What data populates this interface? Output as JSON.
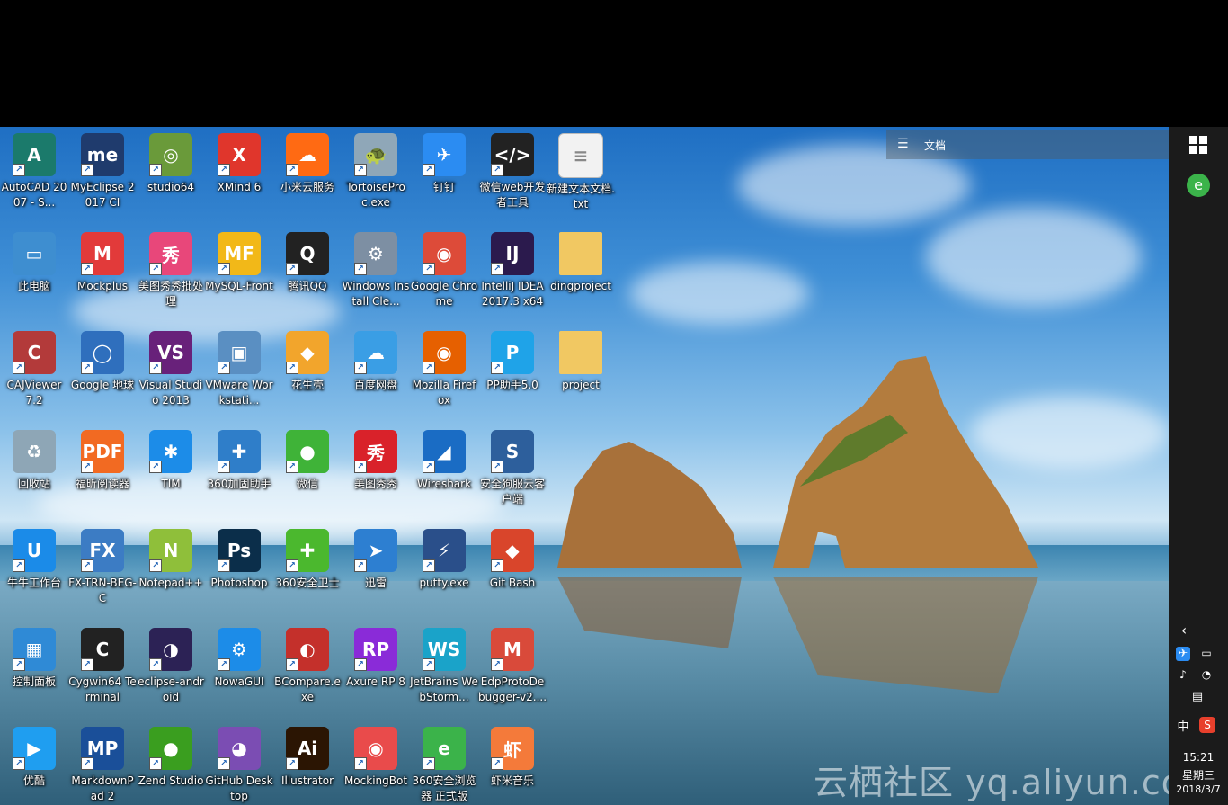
{
  "notebar": {
    "label": "文档"
  },
  "watermark": "云栖社区 yq.aliyun.com",
  "icons": [
    {
      "label": "AutoCAD 2007 - S...",
      "icon": "autocad-icon",
      "bg": "#1b7a6b",
      "glyph": "A"
    },
    {
      "label": "MyEclipse 2017 CI",
      "icon": "myeclipse-icon",
      "bg": "#1f3b6d",
      "glyph": "me"
    },
    {
      "label": "studio64",
      "icon": "android-studio-icon",
      "bg": "#6a9a3a",
      "glyph": "◎"
    },
    {
      "label": "XMind 6",
      "icon": "xmind-icon",
      "bg": "#e0362c",
      "glyph": "X"
    },
    {
      "label": "小米云服务",
      "icon": "mi-cloud-icon",
      "bg": "#ff6a13",
      "glyph": "☁"
    },
    {
      "label": "TortoiseProc.exe",
      "icon": "tortoise-icon",
      "bg": "#8fa7b8",
      "glyph": "🐢"
    },
    {
      "label": "钉钉",
      "icon": "dingtalk-icon",
      "bg": "#2b8cf2",
      "glyph": "✈"
    },
    {
      "label": "微信web开发者工具",
      "icon": "wechat-devtools-icon",
      "bg": "#222",
      "glyph": "</>"
    },
    {
      "label": "新建文本文档.txt",
      "icon": "text-file-icon",
      "bg": "#f2f2f2",
      "glyph": "≡"
    },
    {
      "label": "此电脑",
      "icon": "computer-icon",
      "bg": "#3e8ed0",
      "glyph": "▭"
    },
    {
      "label": "Mockplus",
      "icon": "mockplus-icon",
      "bg": "#e23a3a",
      "glyph": "M"
    },
    {
      "label": "美图秀秀批处理",
      "icon": "meitu-batch-icon",
      "bg": "#e8477a",
      "glyph": "秀"
    },
    {
      "label": "MySQL-Front",
      "icon": "mysql-front-icon",
      "bg": "#f2b818",
      "glyph": "MF"
    },
    {
      "label": "腾讯QQ",
      "icon": "qq-icon",
      "bg": "#222",
      "glyph": "Q"
    },
    {
      "label": "Windows Install Cle...",
      "icon": "windows-installer-icon",
      "bg": "#7d8fa3",
      "glyph": "⚙"
    },
    {
      "label": "Google Chrome",
      "icon": "chrome-icon",
      "bg": "#dd4b39",
      "glyph": "◉"
    },
    {
      "label": "IntelliJ IDEA 2017.3 x64",
      "icon": "intellij-icon",
      "bg": "#2b1a4d",
      "glyph": "IJ"
    },
    {
      "label": "dingproject",
      "icon": "folder-icon",
      "bg": "#f1c862",
      "glyph": ""
    },
    {
      "label": "CAJViewer 7.2",
      "icon": "cajviewer-icon",
      "bg": "#b33a3a",
      "glyph": "C"
    },
    {
      "label": "Google 地球",
      "icon": "google-earth-icon",
      "bg": "#2f6fbd",
      "glyph": "◯"
    },
    {
      "label": "Visual Studio 2013",
      "icon": "visual-studio-icon",
      "bg": "#68217a",
      "glyph": "VS"
    },
    {
      "label": "VMware Workstati...",
      "icon": "vmware-icon",
      "bg": "#5a8fc2",
      "glyph": "▣"
    },
    {
      "label": "花生壳",
      "icon": "peanut-shell-icon",
      "bg": "#f2a52c",
      "glyph": "◆"
    },
    {
      "label": "百度网盘",
      "icon": "baidu-netdisk-icon",
      "bg": "#3a9ee5",
      "glyph": "☁"
    },
    {
      "label": "Mozilla Firefox",
      "icon": "firefox-icon",
      "bg": "#e66000",
      "glyph": "◉"
    },
    {
      "label": "PP助手5.0",
      "icon": "pp-assistant-icon",
      "bg": "#1fa3e8",
      "glyph": "P"
    },
    {
      "label": "project",
      "icon": "folder-icon",
      "bg": "#f1c862",
      "glyph": ""
    },
    {
      "label": "回收站",
      "icon": "recycle-bin-icon",
      "bg": "#8ea6b6",
      "glyph": "♻"
    },
    {
      "label": "福昕阅读器",
      "icon": "foxit-reader-icon",
      "bg": "#f26a22",
      "glyph": "PDF"
    },
    {
      "label": "TIM",
      "icon": "tim-icon",
      "bg": "#1c8ce8",
      "glyph": "✱"
    },
    {
      "label": "360加固助手",
      "icon": "360-jiagu-icon",
      "bg": "#2f7ec9",
      "glyph": "✚"
    },
    {
      "label": "微信",
      "icon": "wechat-icon",
      "bg": "#3fb338",
      "glyph": "●"
    },
    {
      "label": "美图秀秀",
      "icon": "meitu-icon",
      "bg": "#d9222a",
      "glyph": "秀"
    },
    {
      "label": "Wireshark",
      "icon": "wireshark-icon",
      "bg": "#1a6cc4",
      "glyph": "◢"
    },
    {
      "label": "安全狗服云客户端",
      "icon": "safedog-icon",
      "bg": "#2d5f9c",
      "glyph": "S"
    },
    {
      "label": "牛牛工作台",
      "icon": "niuniu-icon",
      "bg": "#1b8be8",
      "glyph": "U"
    },
    {
      "label": "FX-TRN-BEG-C",
      "icon": "fx-trn-icon",
      "bg": "#3c7cc4",
      "glyph": "FX"
    },
    {
      "label": "Notepad++",
      "icon": "notepadpp-icon",
      "bg": "#8fbf3a",
      "glyph": "N"
    },
    {
      "label": "Photoshop",
      "icon": "photoshop-icon",
      "bg": "#0b2e4a",
      "glyph": "Ps"
    },
    {
      "label": "360安全卫士",
      "icon": "360-security-icon",
      "bg": "#4bb82e",
      "glyph": "✚"
    },
    {
      "label": "迅雷",
      "icon": "xunlei-icon",
      "bg": "#2d7fd1",
      "glyph": "➤"
    },
    {
      "label": "putty.exe",
      "icon": "putty-icon",
      "bg": "#2a4f8a",
      "glyph": "⚡"
    },
    {
      "label": "Git Bash",
      "icon": "git-bash-icon",
      "bg": "#d9452b",
      "glyph": "◆"
    },
    {
      "label": "控制面板",
      "icon": "control-panel-icon",
      "bg": "#2f8ad6",
      "glyph": "▦"
    },
    {
      "label": "Cygwin64 Terminal",
      "icon": "cygwin-icon",
      "bg": "#222",
      "glyph": "C"
    },
    {
      "label": "eclipse-android",
      "icon": "eclipse-icon",
      "bg": "#2c2255",
      "glyph": "◑"
    },
    {
      "label": "NowaGUI",
      "icon": "nowagui-icon",
      "bg": "#1c8ce8",
      "glyph": "⚙"
    },
    {
      "label": "BCompare.exe",
      "icon": "bcompare-icon",
      "bg": "#c4302b",
      "glyph": "◐"
    },
    {
      "label": "Axure RP 8",
      "icon": "axure-icon",
      "bg": "#8a2bd8",
      "glyph": "RP"
    },
    {
      "label": "JetBrains WebStorm...",
      "icon": "webstorm-icon",
      "bg": "#1aa3c9",
      "glyph": "WS"
    },
    {
      "label": "EdpProtoDebugger-v2....",
      "icon": "edp-icon",
      "bg": "#d94a3a",
      "glyph": "M"
    },
    {
      "label": "优酷",
      "icon": "youku-icon",
      "bg": "#1f9ef0",
      "glyph": "▶"
    },
    {
      "label": "MarkdownPad 2",
      "icon": "markdownpad-icon",
      "bg": "#1a4f99",
      "glyph": "MP"
    },
    {
      "label": "Zend Studio",
      "icon": "zend-studio-icon",
      "bg": "#3a9e1f",
      "glyph": "●"
    },
    {
      "label": "GitHub Desktop",
      "icon": "github-desktop-icon",
      "bg": "#7b4db3",
      "glyph": "◕"
    },
    {
      "label": "Illustrator",
      "icon": "illustrator-icon",
      "bg": "#2b1503",
      "glyph": "Ai"
    },
    {
      "label": "MockingBot",
      "icon": "mockingbot-icon",
      "bg": "#e94b4b",
      "glyph": "◉"
    },
    {
      "label": "360安全浏览器 正式版",
      "icon": "360-browser-icon",
      "bg": "#3bb34a",
      "glyph": "e"
    },
    {
      "label": "虾米音乐",
      "icon": "xiami-icon",
      "bg": "#f47a3a",
      "glyph": "虾"
    }
  ],
  "taskbar": {
    "clock_time": "15:21",
    "clock_day": "星期三",
    "clock_date": "2018/3/7",
    "ime_label": "中"
  }
}
